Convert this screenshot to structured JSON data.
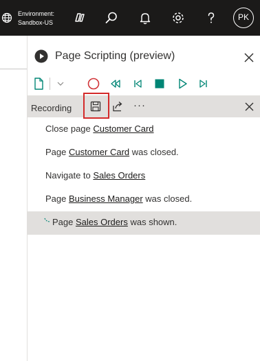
{
  "topbar": {
    "environment_label": "Environment:",
    "environment_name": "Sandbox-US",
    "avatar_initials": "PK"
  },
  "panel": {
    "title": "Page Scripting (preview)",
    "recording_label": "Recording",
    "more_glyph": "···"
  },
  "steps": [
    {
      "pre": "Close page ",
      "link": "Customer Card",
      "post": ""
    },
    {
      "pre": "Page ",
      "link": "Customer Card",
      "post": " was closed."
    },
    {
      "pre": "Navigate to ",
      "link": "Sales Orders",
      "post": ""
    },
    {
      "pre": "Page ",
      "link": "Business Manager",
      "post": " was closed."
    },
    {
      "pre": "Page ",
      "link": "Sales Orders",
      "post": " was shown."
    }
  ],
  "colors": {
    "topbar": "#1b1a19",
    "accent_teal": "#008575",
    "record_red": "#d13438",
    "highlight_red": "#d42a2a"
  }
}
